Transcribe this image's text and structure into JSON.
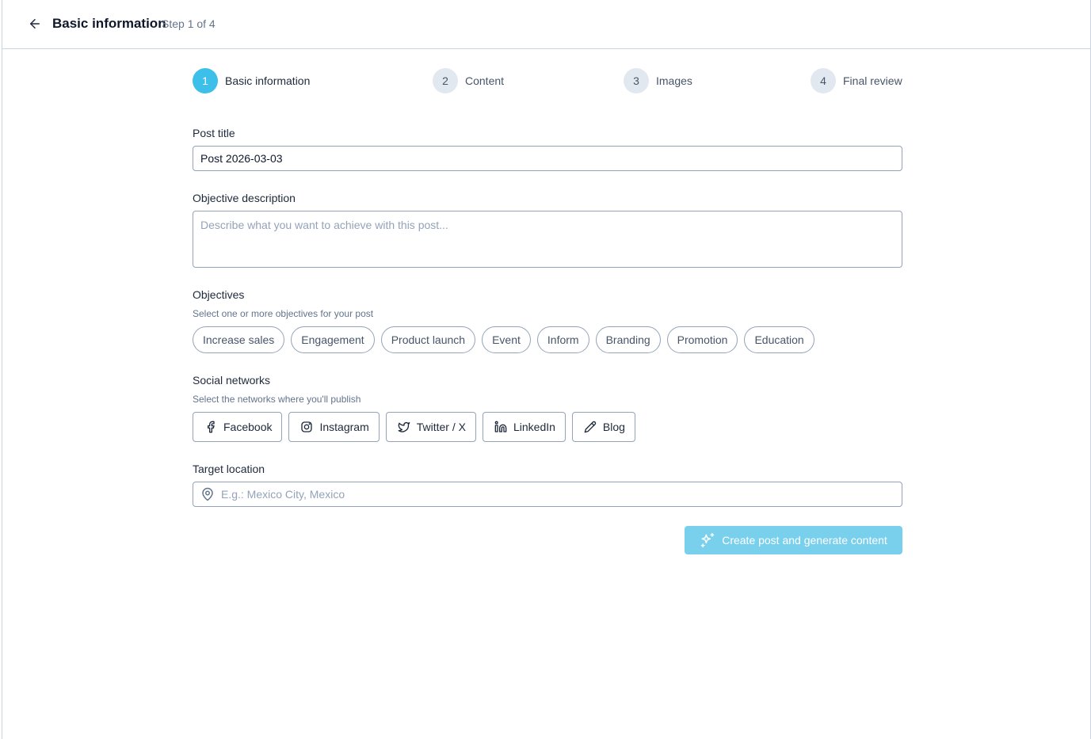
{
  "header": {
    "title": "Basic information",
    "step_label": "Step 1 of 4"
  },
  "stepper": [
    {
      "number": "1",
      "label": "Basic information",
      "active": true
    },
    {
      "number": "2",
      "label": "Content",
      "active": false
    },
    {
      "number": "3",
      "label": "Images",
      "active": false
    },
    {
      "number": "4",
      "label": "Final review",
      "active": false
    }
  ],
  "form": {
    "post_title": {
      "label": "Post title",
      "value": "Post 2026-03-03"
    },
    "objective_description": {
      "label": "Objective description",
      "placeholder": "Describe what you want to achieve with this post..."
    },
    "objectives": {
      "label": "Objectives",
      "hint": "Select one or more objectives for your post",
      "options": [
        "Increase sales",
        "Engagement",
        "Product launch",
        "Event",
        "Inform",
        "Branding",
        "Promotion",
        "Education"
      ]
    },
    "social_networks": {
      "label": "Social networks",
      "hint": "Select the networks where you'll publish",
      "options": [
        {
          "label": "Facebook",
          "icon": "facebook-icon"
        },
        {
          "label": "Instagram",
          "icon": "instagram-icon"
        },
        {
          "label": "Twitter / X",
          "icon": "twitter-icon"
        },
        {
          "label": "LinkedIn",
          "icon": "linkedin-icon"
        },
        {
          "label": "Blog",
          "icon": "pencil-icon"
        }
      ]
    },
    "target_location": {
      "label": "Target location",
      "placeholder": "E.g.: Mexico City, Mexico"
    },
    "submit_label": "Create post and generate content"
  },
  "colors": {
    "accent": "#3cbfe8",
    "submit_disabled": "#79d0ec",
    "border": "#94a3b8"
  }
}
